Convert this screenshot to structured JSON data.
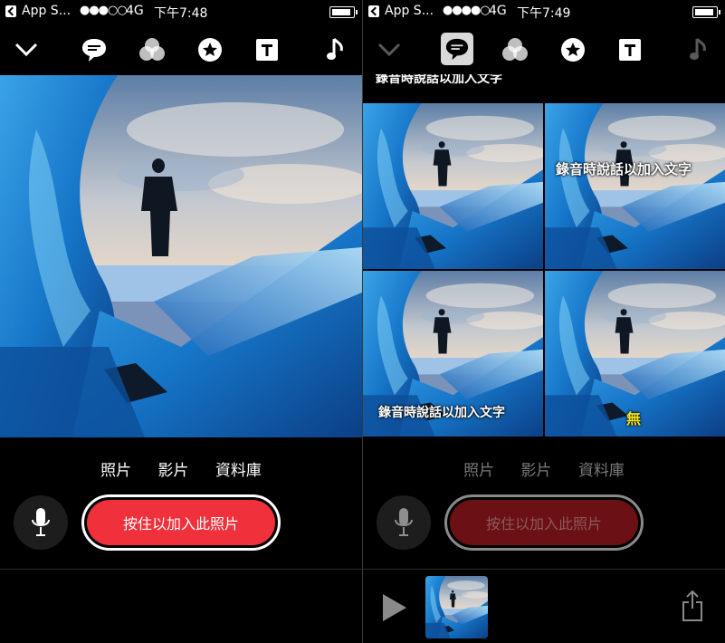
{
  "left": {
    "status": {
      "app": "App S...",
      "signal": "●●●○○",
      "network": "4G",
      "time": "下午7:48"
    },
    "toolbar": [
      "chevron-down-icon",
      "speech-bubble-icon",
      "filters-icon",
      "star-icon",
      "text-icon",
      "music-icon"
    ],
    "tabs": [
      "照片",
      "影片",
      "資料庫"
    ],
    "record_label": "按住以加入此照片"
  },
  "right": {
    "status": {
      "app": "App S...",
      "signal": "●●●●○",
      "network": "4G",
      "time": "下午7:49"
    },
    "toolbar": [
      "chevron-down-icon",
      "speech-bubble-icon",
      "filters-icon",
      "star-icon",
      "text-icon",
      "music-icon"
    ],
    "selected_tool": "speech-bubble-icon",
    "caption_options": [
      {
        "label": "錄音時說話以加入文字",
        "position": "top-strip"
      },
      {
        "label": "",
        "position": "top-strip"
      },
      {
        "label": "",
        "position": "none"
      },
      {
        "label": "錄音時說話以加入文字",
        "position": "upper"
      },
      {
        "label": "錄音時說話以加入文字",
        "position": "bottom"
      },
      {
        "label": "無",
        "position": "bottom-center"
      }
    ],
    "tabs": [
      "照片",
      "影片",
      "資料庫"
    ],
    "record_label": "按住以加入此照片"
  },
  "colors": {
    "record": "#f0303a",
    "background": "#000000",
    "none_label": "#f5e21b"
  }
}
